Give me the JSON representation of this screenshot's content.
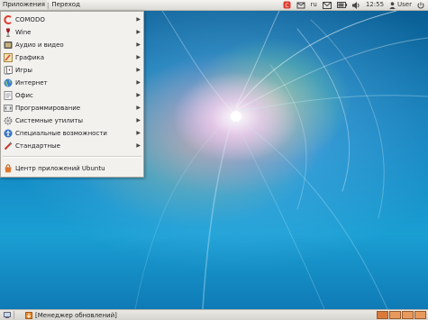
{
  "top_panel": {
    "menus": [
      {
        "label": "Приложения",
        "active": true
      },
      {
        "label": "Переход",
        "active": false
      }
    ],
    "separator": "|",
    "tray": {
      "keyboard_layout": "ru",
      "time": "12:55",
      "user": "User",
      "icons": [
        "comodo-shield-icon",
        "network-icon",
        "mail-icon",
        "battery-icon",
        "volume-icon",
        "user-icon",
        "power-icon"
      ]
    }
  },
  "app_menu": {
    "items": [
      {
        "label": "COMODO",
        "icon": "comodo-icon",
        "submenu": true
      },
      {
        "label": "Wine",
        "icon": "wine-glass-icon",
        "submenu": true
      },
      {
        "label": "Аудио и видео",
        "icon": "multimedia-icon",
        "submenu": true
      },
      {
        "label": "Графика",
        "icon": "graphics-icon",
        "submenu": true
      },
      {
        "label": "Игры",
        "icon": "games-icon",
        "submenu": true
      },
      {
        "label": "Интернет",
        "icon": "globe-icon",
        "submenu": true
      },
      {
        "label": "Офис",
        "icon": "office-icon",
        "submenu": true
      },
      {
        "label": "Программирование",
        "icon": "programming-icon",
        "submenu": true
      },
      {
        "label": "Системные утилиты",
        "icon": "system-tools-icon",
        "submenu": true
      },
      {
        "label": "Специальные возможности",
        "icon": "accessibility-icon",
        "submenu": true
      },
      {
        "label": "Стандартные",
        "icon": "accessories-icon",
        "submenu": true
      },
      {
        "label": "Центр приложений Ubuntu",
        "icon": "software-center-icon",
        "submenu": false
      }
    ],
    "submenu_arrow": "▶"
  },
  "bottom_panel": {
    "task": "[Менеджер обновлений]"
  },
  "colors": {
    "panel": "#e6e4df",
    "menu_bg": "#f2f1ee",
    "workspace": "#d97a3a",
    "comodo_red": "#e03a2e"
  }
}
